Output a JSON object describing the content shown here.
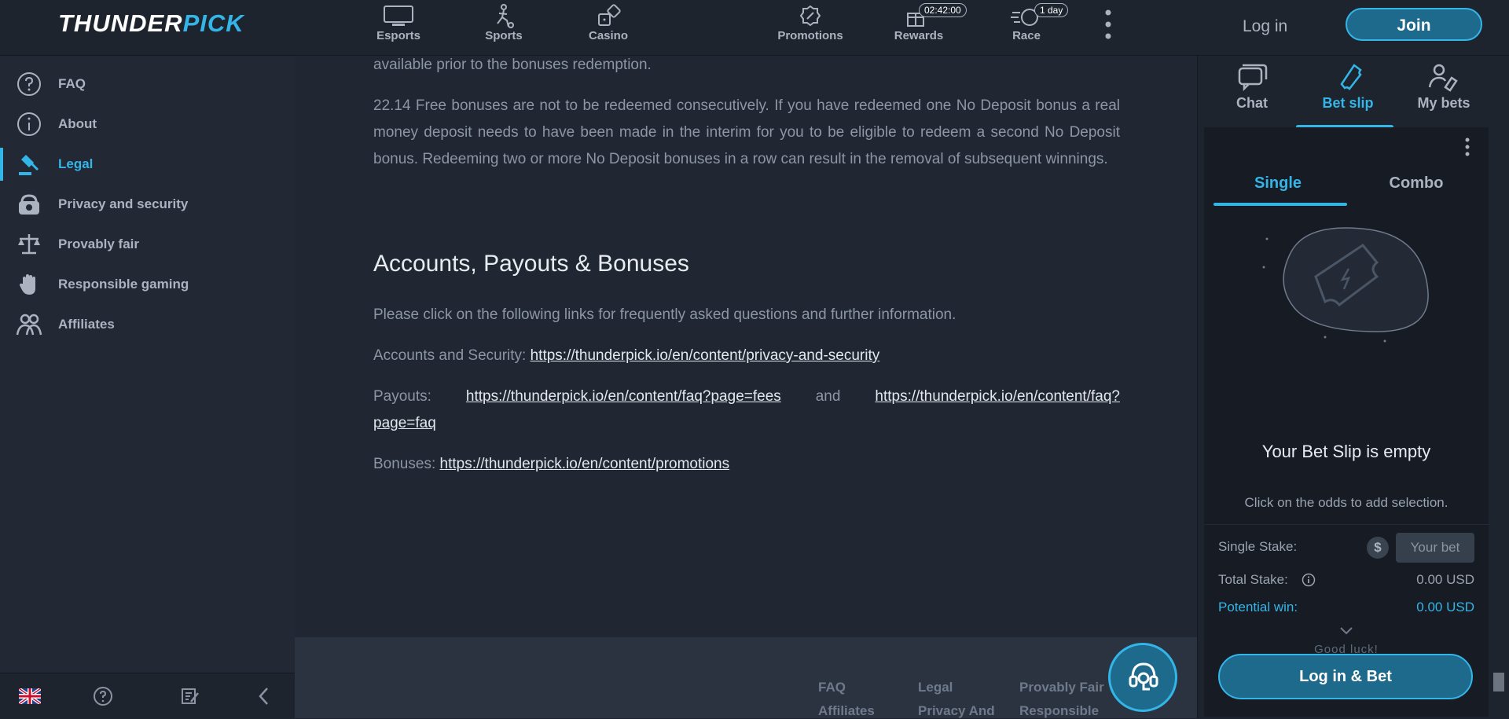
{
  "header": {
    "logo_prefix": "THUNDER",
    "logo_suffix": "PICK",
    "nav": [
      {
        "label": "Esports",
        "icon": "monitor-icon"
      },
      {
        "label": "Sports",
        "icon": "sports-player-icon"
      },
      {
        "label": "Casino",
        "icon": "dice-icon"
      },
      {
        "label": "Promotions",
        "icon": "promotions-badge-icon"
      },
      {
        "label": "Rewards",
        "icon": "gift-icon",
        "badge": "02:42:00"
      },
      {
        "label": "Race",
        "icon": "stopwatch-icon",
        "badge": "1 day"
      }
    ],
    "login": "Log in",
    "join": "Join"
  },
  "sidebar": {
    "items": [
      {
        "label": "FAQ",
        "icon": "question-circle-icon"
      },
      {
        "label": "About",
        "icon": "info-circle-icon"
      },
      {
        "label": "Legal",
        "icon": "gavel-icon",
        "active": true
      },
      {
        "label": "Privacy and security",
        "icon": "lock-bag-icon"
      },
      {
        "label": "Provably fair",
        "icon": "scales-icon"
      },
      {
        "label": "Responsible gaming",
        "icon": "hand-stop-icon"
      },
      {
        "label": "Affiliates",
        "icon": "users-icon"
      }
    ]
  },
  "content": {
    "intro_tail": "available prior to the bonuses redemption.",
    "clause_22_14": "22.14 Free bonuses are not to be redeemed consecutively. If you have redeemed one No Deposit bonus a real money deposit needs to have been made in the interim for you to be eligible to redeem a second No Deposit bonus. Redeeming two or more No Deposit bonuses in a row can result in the removal of subsequent winnings.",
    "section_title": "Accounts, Payouts & Bonuses",
    "section_intro": "Please click on the following links for frequently asked questions and further information.",
    "accounts_label": "Accounts and Security:",
    "accounts_link": "https://thunderpick.io/en/content/privacy-and-security",
    "payouts_label": "Payouts:",
    "payouts_link_1": "https://thunderpick.io/en/content/faq?page=fees",
    "payouts_and": "and",
    "payouts_link_2": "https://thunderpick.io/en/content/faq?page=faq",
    "bonuses_label": "Bonuses:",
    "bonuses_link": "https://thunderpick.io/en/content/promotions"
  },
  "footer": {
    "col1": [
      "FAQ",
      "Affiliates"
    ],
    "col2": [
      "Legal",
      "Privacy And"
    ],
    "col3": [
      "Provably Fair",
      "Responsible"
    ]
  },
  "betslip": {
    "tabs": [
      {
        "label": "Chat",
        "icon": "chat-icon"
      },
      {
        "label": "Bet slip",
        "icon": "ticket-icon",
        "active": true
      },
      {
        "label": "My bets",
        "icon": "user-ticket-icon"
      }
    ],
    "single": "Single",
    "combo": "Combo",
    "empty_title": "Your Bet Slip is empty",
    "empty_hint": "Click on the odds to add selection.",
    "single_stake_label": "Single Stake:",
    "currency_symbol": "$",
    "bet_placeholder": "Your bet",
    "total_stake_label": "Total Stake:",
    "total_stake_value": "0.00 USD",
    "potential_win_label": "Potential win:",
    "potential_win_value": "0.00 USD",
    "good_luck": "Good luck!",
    "login_bet": "Log in & Bet"
  },
  "colors": {
    "accent": "#34b5e8",
    "button_fill": "#1e6a8c",
    "background": "#1f2530"
  }
}
